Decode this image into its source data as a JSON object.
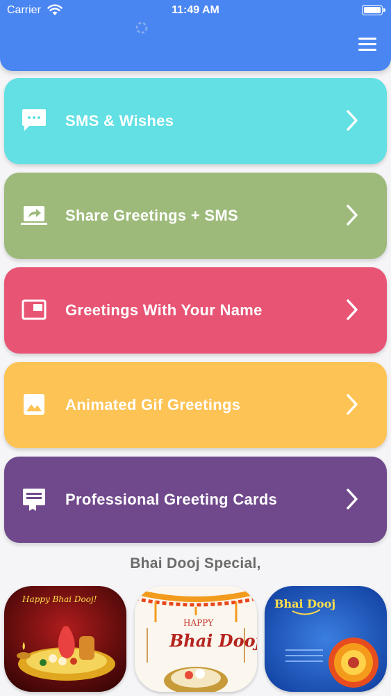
{
  "status_bar": {
    "carrier": "Carrier",
    "time": "11:49 AM",
    "battery_level": 1.0
  },
  "header": {
    "menu_icon": "hamburger-menu-icon",
    "loader_icon": "loading-spinner-icon",
    "background": "#4a86f2"
  },
  "menu": [
    {
      "label": "SMS & Wishes",
      "icon": "chat-bubble-icon",
      "color": "#62e0e4"
    },
    {
      "label": "Share Greetings + SMS",
      "icon": "share-screen-icon",
      "color": "#9dba7a"
    },
    {
      "label": "Greetings With Your Name",
      "icon": "picture-in-picture-icon",
      "color": "#e85474"
    },
    {
      "label": "Animated Gif Greetings",
      "icon": "image-icon",
      "color": "#fec355"
    },
    {
      "label": "Professional Greeting Cards",
      "icon": "card-ribbon-icon",
      "color": "#70498c"
    }
  ],
  "special": {
    "title": "Bhai Dooj Special,",
    "cards": [
      {
        "name": "thali-greeting-card",
        "caption": "Happy Bhai Dooj!"
      },
      {
        "name": "marigold-greeting-card",
        "caption_top": "HAPPY",
        "caption": "Bhai Dooj."
      },
      {
        "name": "blue-rangoli-greeting-card",
        "caption": "Bhai Dooj"
      }
    ]
  }
}
